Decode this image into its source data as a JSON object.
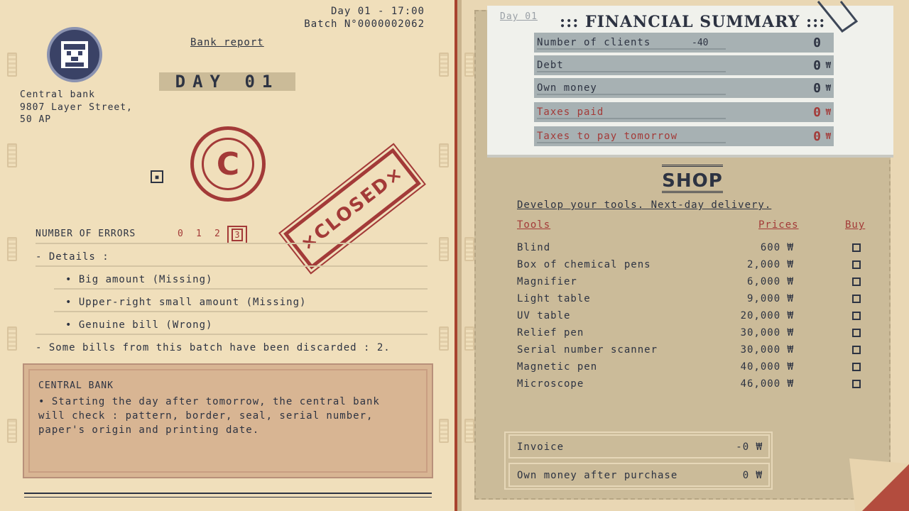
{
  "header": {
    "day_time": "Day 01 - 17:00",
    "batch": "Batch N°0000002062"
  },
  "report": {
    "title": "Bank report",
    "day_banner": "DAY 01",
    "address_lines": [
      "Central bank",
      "9807 Layer Street,",
      "50 AP"
    ],
    "stamp_text": "×CLOSED×",
    "seal_letter": "C",
    "errors_label": "NUMBER OF ERRORS",
    "error_options": [
      "0",
      "1",
      "2",
      "3"
    ],
    "errors_selected": "3",
    "details_label": "- Details :",
    "details": [
      "• Big amount (Missing)",
      "• Upper-right small amount (Missing)",
      "• Genuine bill (Wrong)"
    ],
    "discarded": "- Some bills from this batch have been discarded : 2."
  },
  "central_bank_notice": {
    "title": "CENTRAL BANK",
    "text": "• Starting the day after tomorrow, the central bank will check : pattern, border, seal, serial number, paper's origin and printing date."
  },
  "summary": {
    "day": "Day 01",
    "title": "::: FINANCIAL SUMMARY :::",
    "rows": [
      {
        "label": "Number of clients",
        "extra": "-40",
        "value": "0",
        "currency": ""
      },
      {
        "label": "Debt",
        "extra": "",
        "value": "0",
        "currency": "₩"
      },
      {
        "label": "Own money",
        "extra": "",
        "value": "0",
        "currency": "₩"
      },
      {
        "label": "Taxes paid",
        "extra": "",
        "value": "0",
        "currency": "₩"
      },
      {
        "label": "Taxes to pay tomorrow",
        "extra": "",
        "value": "0",
        "currency": "₩"
      }
    ]
  },
  "shop": {
    "title": "SHOP",
    "subtitle": "Develop your tools. Next-day delivery.",
    "columns": {
      "tools": "Tools",
      "prices": "Prices",
      "buy": "Buy"
    },
    "items": [
      {
        "name": "Blind",
        "price": "600 ₩"
      },
      {
        "name": "Box of chemical pens",
        "price": "2,000 ₩"
      },
      {
        "name": "Magnifier",
        "price": "6,000 ₩"
      },
      {
        "name": "Light table",
        "price": "9,000 ₩"
      },
      {
        "name": "UV table",
        "price": "20,000 ₩"
      },
      {
        "name": "Relief pen",
        "price": "30,000 ₩"
      },
      {
        "name": "Serial number scanner",
        "price": "30,000 ₩"
      },
      {
        "name": "Magnetic pen",
        "price": "40,000 ₩"
      },
      {
        "name": "Microscope",
        "price": "46,000 ₩"
      }
    ],
    "invoice_label": "Invoice",
    "invoice_value": "-0 ₩",
    "after_label": "Own money after purchase",
    "after_value": "0 ₩"
  },
  "colors": {
    "paper": "#f0dfbb",
    "stamp_red": "#a33a38",
    "ink": "#2d3342",
    "summary_row": "#a7b1b3",
    "notice_box": "#d8b593"
  }
}
